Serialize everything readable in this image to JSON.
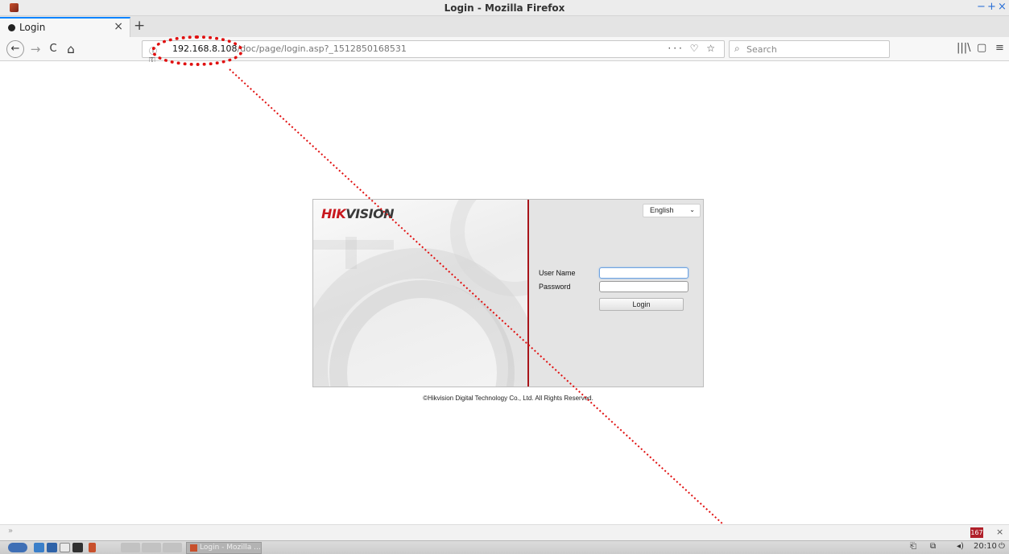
{
  "window": {
    "title": "Login - Mozilla Firefox",
    "controls": [
      "−",
      "+",
      "×"
    ]
  },
  "tab": {
    "label": "Login",
    "close": "×",
    "new_tab": "+"
  },
  "nav": {
    "back": "←",
    "forward": "→",
    "reload": "C",
    "home": "⌂",
    "url_host": "192.168.8.108",
    "url_rest": "/doc/page/login.asp?_1512850168531",
    "page_actions": "··· ♡ ☆",
    "search_placeholder": "Search",
    "library": "|||\\",
    "sidebar": "▢",
    "menu": "≡"
  },
  "login": {
    "logo_red": "HIK",
    "logo_gray": "VISION",
    "language": "English",
    "username_label": "User Name",
    "password_label": "Password",
    "username_value": "",
    "password_value": "",
    "login_button": "Login",
    "copyright": "©Hikvision Digital Technology Co., Ltd. All Rights Reserved."
  },
  "statusbar": {
    "badge": "167",
    "close": "×"
  },
  "taskbar": {
    "task_label": "Login - Mozilla ...",
    "clock": "20:10"
  },
  "colors": {
    "hik_red": "#c8181e",
    "accent_blue": "#0a84ff",
    "annotation_red": "#e01010"
  }
}
